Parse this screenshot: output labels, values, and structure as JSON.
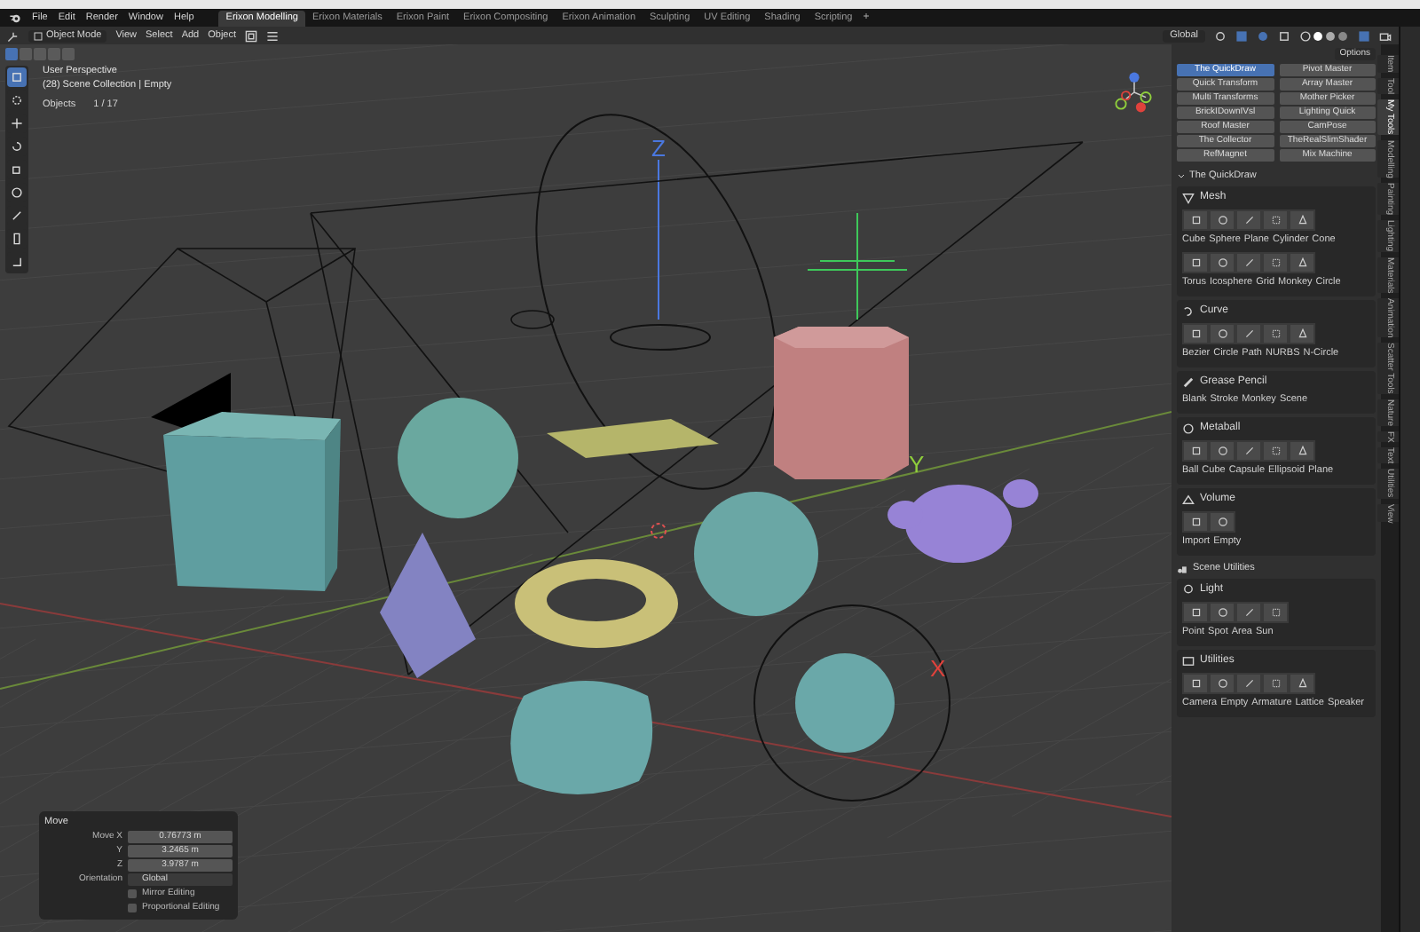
{
  "menu_bar": {
    "items": [
      "File",
      "Edit",
      "Render",
      "Window",
      "Help"
    ],
    "workspaces": [
      {
        "label": "Erixon Modelling",
        "selected": true
      },
      {
        "label": "Erixon Materials",
        "selected": false
      },
      {
        "label": "Erixon Paint",
        "selected": false
      },
      {
        "label": "Erixon Compositing",
        "selected": false
      },
      {
        "label": "Erixon Animation",
        "selected": false
      },
      {
        "label": "Sculpting",
        "selected": false
      },
      {
        "label": "UV Editing",
        "selected": false
      },
      {
        "label": "Shading",
        "selected": false
      },
      {
        "label": "Scripting",
        "selected": false
      }
    ],
    "add_tab": "+"
  },
  "header": {
    "mode": "Object Mode",
    "menus": [
      "View",
      "Select",
      "Add",
      "Object"
    ],
    "orientation": "Global"
  },
  "toolbar": {
    "select_modes": [
      {
        "selected": true
      },
      {
        "selected": false
      },
      {
        "selected": false
      },
      {
        "selected": false
      },
      {
        "selected": false
      }
    ],
    "tools": [
      {
        "kind": "select",
        "selected": true
      },
      {
        "kind": "cursor",
        "selected": false
      },
      {
        "kind": "move",
        "selected": false
      },
      {
        "kind": "rotate",
        "selected": false
      },
      {
        "kind": "scale",
        "selected": false
      },
      {
        "kind": "transform",
        "selected": false
      },
      {
        "kind": "annotate",
        "selected": false
      },
      {
        "kind": "measure",
        "selected": false
      },
      {
        "kind": "add",
        "selected": false
      }
    ]
  },
  "viewport": {
    "perspective": "User Perspective",
    "collection": "(28) Scene Collection | Empty",
    "objects_label": "Objects",
    "objects_value": "1 / 17",
    "options": "Options",
    "axis_labels": [
      {
        "kind": "z",
        "text": "Z"
      },
      {
        "kind": "y",
        "text": "Y"
      },
      {
        "kind": "x",
        "text": "X"
      }
    ]
  },
  "move_panel": {
    "title": "Move",
    "fields": [
      {
        "label": "Move X",
        "value": "0.76773 m"
      },
      {
        "label": "Y",
        "value": "3.2465 m"
      },
      {
        "label": "Z",
        "value": "3.9787 m"
      }
    ],
    "orientation_label": "Orientation",
    "orientation": "Global",
    "options": [
      {
        "label": "Mirror Editing",
        "checked": false
      },
      {
        "label": "Proportional Editing",
        "checked": false
      }
    ]
  },
  "sidebar": {
    "addon_buttons": [
      {
        "label": "The QuickDraw",
        "selected": true
      },
      {
        "label": "Pivot Master",
        "selected": false
      },
      {
        "label": "Quick Transform",
        "selected": false
      },
      {
        "label": "Array Master",
        "selected": false
      },
      {
        "label": "Multi Transforms",
        "selected": false
      },
      {
        "label": "Mother Picker",
        "selected": false
      },
      {
        "label": "BrickIDownIVsl",
        "selected": false
      },
      {
        "label": "Lighting Quick",
        "selected": false
      },
      {
        "label": "Roof Master",
        "selected": false
      },
      {
        "label": "CamPose",
        "selected": false
      },
      {
        "label": "The Collector",
        "selected": false
      },
      {
        "label": "TheRealSlimShader",
        "selected": false
      },
      {
        "label": "RefMagnet",
        "selected": false
      },
      {
        "label": "Mix Machine",
        "selected": false
      }
    ],
    "panel_title": "The QuickDraw",
    "sections": [
      {
        "title": "Mesh",
        "kind": "mesh",
        "rows": [
          {
            "kind": "icons",
            "labels": [
              "Cube",
              "Sphere",
              "Plane",
              "Cylinder",
              "Cone"
            ]
          },
          {
            "kind": "icons",
            "labels": [
              "Torus",
              "Icosphere",
              "Grid",
              "Monkey",
              "Circle"
            ]
          }
        ]
      },
      {
        "title": "Curve",
        "kind": "curve",
        "rows": [
          {
            "kind": "icons",
            "labels": [
              "Bezier",
              "Circle",
              "Path",
              "NURBS",
              "N-Circle"
            ]
          }
        ]
      },
      {
        "title": "Grease Pencil",
        "kind": "pencil",
        "rows": [
          {
            "kind": "text",
            "labels": [
              "Blank",
              "Stroke",
              "Monkey",
              "Scene"
            ]
          }
        ]
      },
      {
        "title": "Metaball",
        "kind": "metaball",
        "rows": [
          {
            "kind": "icons",
            "labels": [
              "Ball",
              "Cube",
              "Capsule",
              "Ellipsoid",
              "Plane"
            ]
          }
        ]
      },
      {
        "title": "Volume",
        "kind": "volume",
        "rows": [
          {
            "kind": "icons",
            "labels": [
              "Import",
              "Empty"
            ]
          }
        ]
      }
    ],
    "utilities_title": "Scene Utilities",
    "utility_sections": [
      {
        "title": "Light",
        "kind": "light",
        "rows": [
          {
            "kind": "icons",
            "labels": [
              "Point",
              "Spot",
              "Area",
              "Sun"
            ]
          }
        ]
      },
      {
        "title": "Utilities",
        "kind": "utilities",
        "rows": [
          {
            "kind": "icons",
            "labels": [
              "Camera",
              "Empty",
              "Armature",
              "Lattice",
              "Speaker"
            ]
          }
        ]
      }
    ],
    "tabs": [
      {
        "label": "Item",
        "selected": false
      },
      {
        "label": "Tool",
        "selected": false
      },
      {
        "label": "My Tools",
        "selected": true
      },
      {
        "label": "Modelling",
        "selected": false
      },
      {
        "label": "Painting",
        "selected": false
      },
      {
        "label": "Lighting",
        "selected": false
      },
      {
        "label": "Materials",
        "selected": false
      },
      {
        "label": "Animation",
        "selected": false
      },
      {
        "label": "Scatter Tools",
        "selected": false
      },
      {
        "label": "Nature",
        "selected": false
      },
      {
        "label": "FX",
        "selected": false
      },
      {
        "label": "Text",
        "selected": false
      },
      {
        "label": "Utilities",
        "selected": false
      },
      {
        "label": "View",
        "selected": false
      }
    ]
  }
}
